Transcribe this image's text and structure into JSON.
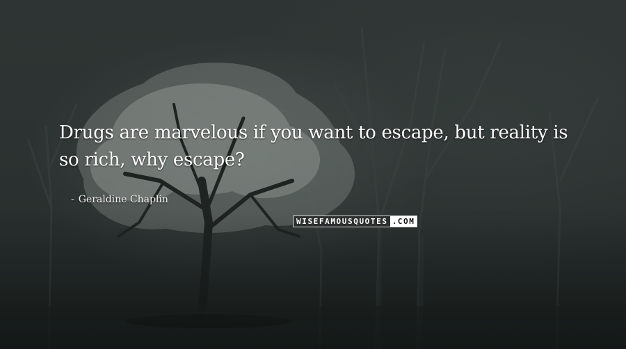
{
  "quote": {
    "line1": "Drugs are marvelous if you want to escape, but reality is",
    "line2": "so rich, why escape?"
  },
  "author": {
    "dash": "-",
    "name": "Geraldine Chaplin"
  },
  "watermark": {
    "main": "WISEFAMOUSQUOTES",
    "tld": ".COM"
  },
  "colors": {
    "background": "#262c2b",
    "text": "#ffffff"
  }
}
